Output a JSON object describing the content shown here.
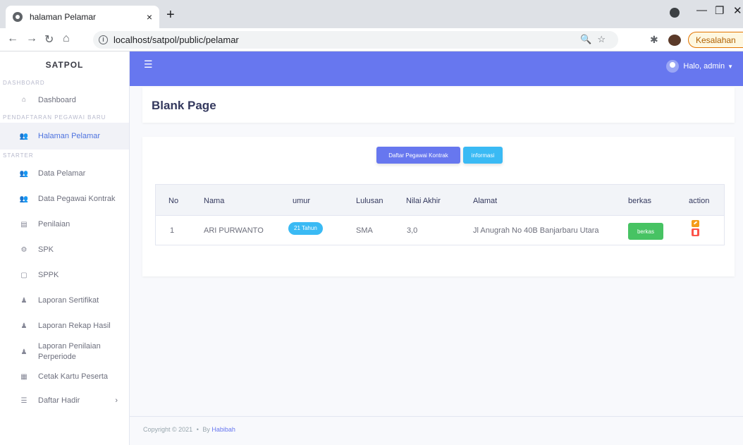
{
  "browser": {
    "tab_title": "halaman Pelamar",
    "tab_close": "×",
    "new_tab": "+",
    "url": "localhost/satpol/public/pelamar",
    "error_label": "Kesalahan"
  },
  "sidebar": {
    "brand": "SATPOL",
    "sections": [
      {
        "heading": "DASHBOARD",
        "items": [
          {
            "label": "Dashboard",
            "icon": "home-icon"
          }
        ]
      },
      {
        "heading": "PENDAFTARAN PEGAWAI BARU",
        "items": [
          {
            "label": "Halaman Pelamar",
            "icon": "users-icon",
            "active": true
          }
        ]
      },
      {
        "heading": "STARTER",
        "items": [
          {
            "label": "Data Pelamar",
            "icon": "users-icon"
          },
          {
            "label": "Data Pegawai Kontrak",
            "icon": "users-icon"
          },
          {
            "label": "Penilaian",
            "icon": "clipboard-icon"
          },
          {
            "label": "SPK",
            "icon": "user-cog-icon"
          },
          {
            "label": "SPPK",
            "icon": "square-icon"
          },
          {
            "label": "Laporan Sertifikat",
            "icon": "user-icon"
          },
          {
            "label": "Laporan Rekap Hasil",
            "icon": "user-group-icon"
          },
          {
            "label": "Laporan Penilaian Perperiode",
            "icon": "user-group-icon"
          },
          {
            "label": "Cetak Kartu Peserta",
            "icon": "id-card-icon"
          },
          {
            "label": "Daftar Hadir",
            "icon": "list-icon"
          }
        ]
      }
    ]
  },
  "navbar": {
    "greeting": "Halo, admin"
  },
  "main": {
    "page_title": "Blank Page",
    "buttons": {
      "daftar_pegawai_kontrak": "Daftar Pegawai Kontrak",
      "informasi": "informasi"
    },
    "table": {
      "headers": [
        "No",
        "Nama",
        "umur",
        "Lulusan",
        "Nilai Akhir",
        "Alamat",
        "berkas",
        "action"
      ],
      "rows": [
        {
          "no": "1",
          "nama": "ARI PURWANTO",
          "umur": "21 Tahun",
          "lulusan": "SMA",
          "nilai_akhir": "3,0",
          "alamat": "Jl Anugrah No 40B Banjarbaru Utara",
          "berkas": "berkas"
        }
      ]
    }
  },
  "footer": {
    "copyright": "Copyright © 2021",
    "separator": "•",
    "by": "By",
    "author": "Habibah"
  },
  "colors": {
    "navbar": "#6777ef",
    "primary": "#6777ef",
    "info": "#3abaf4",
    "success": "#47c363",
    "warning": "#f59c1a",
    "danger": "#fc544b"
  }
}
